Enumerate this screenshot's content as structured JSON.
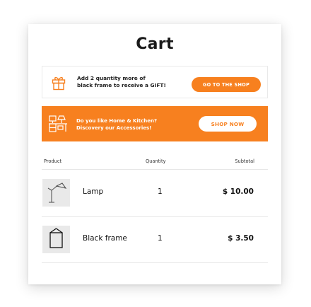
{
  "page": {
    "title": "Cart"
  },
  "gift_banner": {
    "icon": "gift-icon",
    "line1": "Add 2 quantity more of",
    "line2": "black frame to receive a GIFT!",
    "button_label": "GO TO THE SHOP"
  },
  "accessory_banner": {
    "icon": "desk-icon",
    "line1": "Do you like Home & Kitchen?",
    "line2": "Discovery our Accessories!",
    "button_label": "SHOP NOW"
  },
  "table": {
    "headers": {
      "product": "Product",
      "quantity": "Quantity",
      "subtotal": "Subtotal"
    },
    "rows": [
      {
        "icon": "lamp-icon",
        "name": "Lamp",
        "quantity": "1",
        "subtotal": "$ 10.00"
      },
      {
        "icon": "frame-icon",
        "name": "Black frame",
        "quantity": "1",
        "subtotal": "$ 3.50"
      }
    ]
  },
  "colors": {
    "accent": "#f7801f",
    "thumbnail_bg": "#e9e9e9",
    "divider": "#e6e6e6"
  }
}
